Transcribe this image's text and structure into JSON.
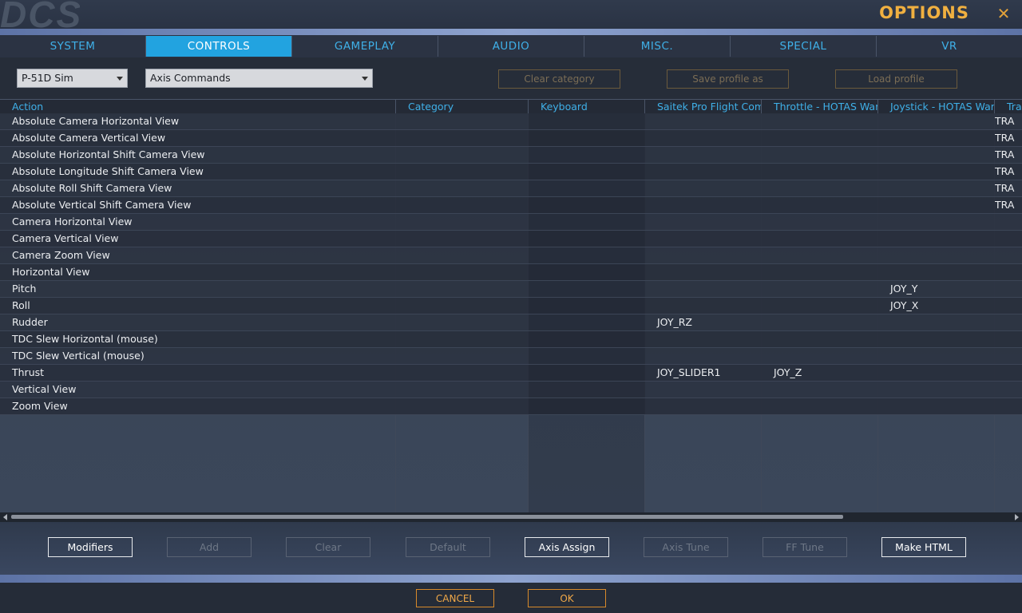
{
  "window": {
    "logo": "DCS",
    "title": "OPTIONS"
  },
  "tabs": [
    {
      "label": "SYSTEM",
      "active": false
    },
    {
      "label": "CONTROLS",
      "active": true
    },
    {
      "label": "GAMEPLAY",
      "active": false
    },
    {
      "label": "AUDIO",
      "active": false
    },
    {
      "label": "MISC.",
      "active": false
    },
    {
      "label": "SPECIAL",
      "active": false
    },
    {
      "label": "VR",
      "active": false
    }
  ],
  "toolbar": {
    "aircraft_select": "P-51D Sim",
    "category_select": "Axis Commands",
    "clear_category": "Clear category",
    "save_profile": "Save profile as",
    "load_profile": "Load profile"
  },
  "table": {
    "columns": [
      "Action",
      "Category",
      "Keyboard",
      "Saitek Pro Flight Comb",
      "Throttle - HOTAS Wart",
      "Joystick - HOTAS Warth",
      "Tra"
    ],
    "rows": [
      {
        "action": "Absolute Camera Horizontal View",
        "category": "",
        "keyboard": "",
        "saitek": "",
        "throttle": "",
        "joystick": "",
        "track": "TRA"
      },
      {
        "action": "Absolute Camera Vertical View",
        "category": "",
        "keyboard": "",
        "saitek": "",
        "throttle": "",
        "joystick": "",
        "track": "TRA"
      },
      {
        "action": "Absolute Horizontal Shift Camera View",
        "category": "",
        "keyboard": "",
        "saitek": "",
        "throttle": "",
        "joystick": "",
        "track": "TRA"
      },
      {
        "action": "Absolute Longitude Shift Camera View",
        "category": "",
        "keyboard": "",
        "saitek": "",
        "throttle": "",
        "joystick": "",
        "track": "TRA"
      },
      {
        "action": "Absolute Roll Shift Camera View",
        "category": "",
        "keyboard": "",
        "saitek": "",
        "throttle": "",
        "joystick": "",
        "track": "TRA"
      },
      {
        "action": "Absolute Vertical Shift Camera View",
        "category": "",
        "keyboard": "",
        "saitek": "",
        "throttle": "",
        "joystick": "",
        "track": "TRA"
      },
      {
        "action": "Camera Horizontal View",
        "category": "",
        "keyboard": "",
        "saitek": "",
        "throttle": "",
        "joystick": "",
        "track": ""
      },
      {
        "action": "Camera Vertical View",
        "category": "",
        "keyboard": "",
        "saitek": "",
        "throttle": "",
        "joystick": "",
        "track": ""
      },
      {
        "action": "Camera Zoom View",
        "category": "",
        "keyboard": "",
        "saitek": "",
        "throttle": "",
        "joystick": "",
        "track": ""
      },
      {
        "action": "Horizontal View",
        "category": "",
        "keyboard": "",
        "saitek": "",
        "throttle": "",
        "joystick": "",
        "track": ""
      },
      {
        "action": "Pitch",
        "category": "",
        "keyboard": "",
        "saitek": "",
        "throttle": "",
        "joystick": "JOY_Y",
        "track": ""
      },
      {
        "action": "Roll",
        "category": "",
        "keyboard": "",
        "saitek": "",
        "throttle": "",
        "joystick": "JOY_X",
        "track": ""
      },
      {
        "action": "Rudder",
        "category": "",
        "keyboard": "",
        "saitek": "JOY_RZ",
        "throttle": "",
        "joystick": "",
        "track": ""
      },
      {
        "action": "TDC Slew Horizontal (mouse)",
        "category": "",
        "keyboard": "",
        "saitek": "",
        "throttle": "",
        "joystick": "",
        "track": ""
      },
      {
        "action": "TDC Slew Vertical (mouse)",
        "category": "",
        "keyboard": "",
        "saitek": "",
        "throttle": "",
        "joystick": "",
        "track": ""
      },
      {
        "action": "Thrust",
        "category": "",
        "keyboard": "",
        "saitek": "JOY_SLIDER1",
        "throttle": "JOY_Z",
        "joystick": "",
        "track": ""
      },
      {
        "action": "Vertical View",
        "category": "",
        "keyboard": "",
        "saitek": "",
        "throttle": "",
        "joystick": "",
        "track": ""
      },
      {
        "action": "Zoom View",
        "category": "",
        "keyboard": "",
        "saitek": "",
        "throttle": "",
        "joystick": "",
        "track": ""
      }
    ]
  },
  "actions": [
    {
      "label": "Modifiers",
      "enabled": true
    },
    {
      "label": "Add",
      "enabled": false
    },
    {
      "label": "Clear",
      "enabled": false
    },
    {
      "label": "Default",
      "enabled": false
    },
    {
      "label": "Axis Assign",
      "enabled": true
    },
    {
      "label": "Axis Tune",
      "enabled": false
    },
    {
      "label": "FF Tune",
      "enabled": false
    },
    {
      "label": "Make HTML",
      "enabled": true
    }
  ],
  "footer": {
    "cancel": "CANCEL",
    "ok": "OK"
  },
  "colors": {
    "accent": "#22a3e0",
    "title": "#f0b040",
    "footer_button": "#d88a2a"
  }
}
